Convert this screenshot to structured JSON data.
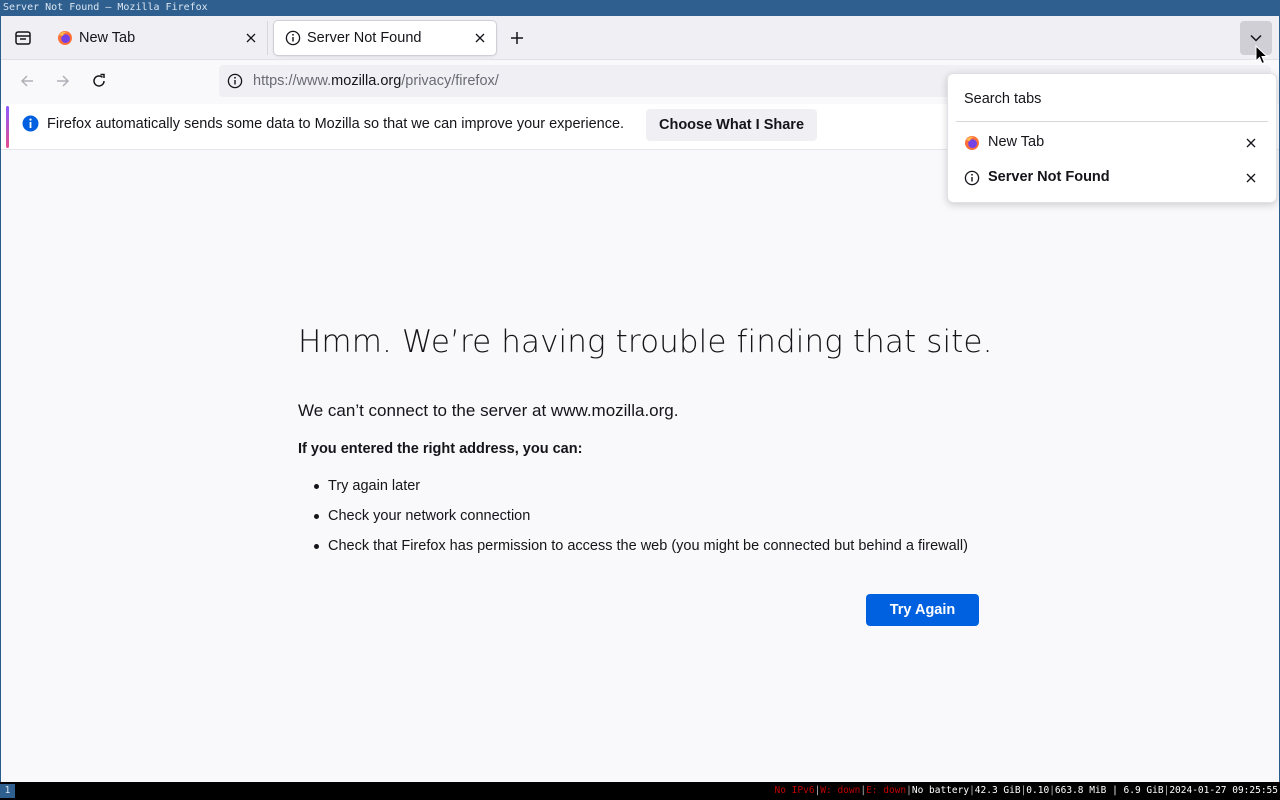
{
  "window": {
    "title": "Server Not Found — Mozilla Firefox"
  },
  "tabs": [
    {
      "label": "New Tab",
      "icon": "firefox-icon"
    },
    {
      "label": "Server Not Found",
      "icon": "info-icon",
      "active": true
    }
  ],
  "url": {
    "prefix": "https://www.",
    "host": "mozilla.org",
    "path": "/privacy/firefox/"
  },
  "notification": {
    "text": "Firefox automatically sends some data to Mozilla so that we can improve your experience.",
    "button": "Choose What I Share"
  },
  "error_page": {
    "title": "Hmm. We’re having trouble finding that site.",
    "description": "We can’t connect to the server at www.mozilla.org.",
    "subheading": "If you entered the right address, you can:",
    "suggestions": [
      "Try again later",
      "Check your network connection",
      "Check that Firefox has permission to access the web (you might be connected but behind a firewall)"
    ],
    "button": "Try Again"
  },
  "tabs_panel": {
    "search_label": "Search tabs",
    "items": [
      {
        "label": "New Tab",
        "icon": "firefox-icon"
      },
      {
        "label": "Server Not Found",
        "icon": "info-icon"
      }
    ]
  },
  "taskbar": {
    "workspace": "1",
    "red_items": [
      "No IPv6",
      "W: down",
      "E: down"
    ],
    "battery": "No battery",
    "disk": "42.3 GiB",
    "load": "0.10",
    "memory": "663.8 MiB | 6.9 GiB",
    "datetime": "2024-01-27 09:25:55"
  },
  "colors": {
    "accent": "#0061e0",
    "titlebar": "#2e5f8e",
    "alert_red": "#c00000"
  }
}
